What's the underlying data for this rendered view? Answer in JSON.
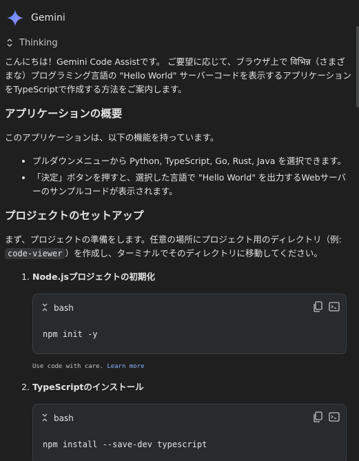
{
  "header": {
    "title": "Gemini"
  },
  "thinking": {
    "label": "Thinking"
  },
  "intro": "こんにちは！Gemini Code Assistです。 ご要望に応じて、ブラウザ上で विभिन्न（さまざまな）プログラミング言語の \"Hello World\" サーバーコードを表示するアプリケーションをTypeScriptで作成する方法をご案内します。",
  "section1": {
    "heading": "アプリケーションの概要",
    "lead": "このアプリケーションは、以下の機能を持っています。",
    "bullets": [
      "プルダウンメニューから Python, TypeScript, Go, Rust, Java を選択できます。",
      "「決定」ボタンを押すと、選択した言語で \"Hello World\" を出力するWebサーバーのサンプルコードが表示されます。"
    ]
  },
  "section2": {
    "heading": "プロジェクトのセットアップ",
    "lead_before": "まず、プロジェクトの準備をします。任意の場所にプロジェクト用のディレクトリ（例: ",
    "lead_code": "code-viewer",
    "lead_after": "）を作成し、ターミナルでそのディレクトリに移動してください。"
  },
  "steps": [
    {
      "title": "Node.jsプロジェクトの初期化",
      "lang": "bash",
      "code": "npm init -y"
    },
    {
      "title": "TypeScriptのインストール",
      "lang": "bash",
      "code": "npm install --save-dev typescript"
    }
  ],
  "care": {
    "text": "Use code with care. ",
    "link": "Learn more"
  },
  "colors": {
    "background": "#1f1f1f",
    "codebox": "#282a2c",
    "link": "#8ab4f8",
    "accent_star": "#4f8ff7"
  }
}
